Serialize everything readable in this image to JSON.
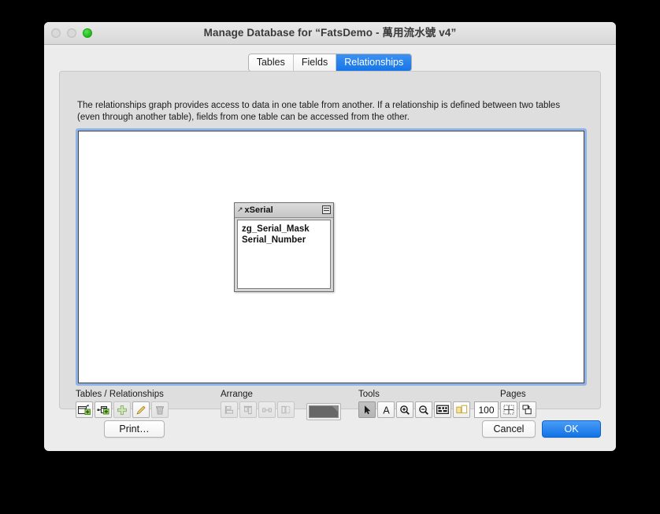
{
  "window": {
    "title": "Manage Database for “FatsDemo - 萬用流水號 v4”",
    "traffic_lights": [
      {
        "name": "close",
        "state": "disabled",
        "color": "#d9d9d9"
      },
      {
        "name": "minimize",
        "state": "disabled",
        "color": "#d9d9d9"
      },
      {
        "name": "zoom",
        "state": "enabled",
        "color": "#23c01a"
      }
    ]
  },
  "tabs": [
    {
      "label": "Tables",
      "active": false
    },
    {
      "label": "Fields",
      "active": false
    },
    {
      "label": "Relationships",
      "active": true
    }
  ],
  "description": "The relationships graph provides access to data in one table from another. If a relationship is defined between two tables (even through another table), fields from one table can be accessed from the other.",
  "graph": {
    "focus_color": "#8cb4e8",
    "tables": [
      {
        "name": "xSerial",
        "source_icon": "external-source-arrow-icon",
        "menu_icon": "table-options-icon",
        "fields": [
          "zg_Serial_Mask",
          "Serial_Number"
        ]
      }
    ]
  },
  "toolbar": {
    "groups": [
      {
        "label": "Tables / Relationships",
        "buttons": [
          {
            "icon": "add-table-icon",
            "enabled": true
          },
          {
            "icon": "add-relationship-icon",
            "enabled": true
          },
          {
            "icon": "duplicate-icon",
            "enabled": false
          },
          {
            "icon": "edit-pencil-icon",
            "enabled": true
          },
          {
            "icon": "delete-trash-icon",
            "enabled": false
          }
        ]
      },
      {
        "label": "Arrange",
        "buttons": [
          {
            "icon": "align-left-icon",
            "enabled": false
          },
          {
            "icon": "align-top-icon",
            "enabled": false
          },
          {
            "icon": "distribute-horizontal-icon",
            "enabled": false
          },
          {
            "icon": "resize-to-fit-icon",
            "enabled": false
          }
        ]
      },
      {
        "label": "Tools",
        "buttons": [
          {
            "icon": "pointer-arrow-icon",
            "enabled": true,
            "selected": true
          },
          {
            "icon": "text-tool-icon",
            "enabled": true
          },
          {
            "icon": "zoom-in-icon",
            "enabled": true
          },
          {
            "icon": "zoom-out-icon",
            "enabled": true
          },
          {
            "icon": "select-all-tables-icon",
            "enabled": true
          },
          {
            "icon": "toggle-note-icon",
            "enabled": true
          }
        ]
      },
      {
        "label": "Pages",
        "buttons": [
          {
            "icon": "page-breaks-icon",
            "enabled": true
          },
          {
            "icon": "page-setup-icon",
            "enabled": true
          }
        ]
      }
    ],
    "color_swatch": {
      "name": "table-color-swatch",
      "color": "#676767"
    },
    "zoom": {
      "value": "100",
      "unit": "%"
    }
  },
  "footer": {
    "print_label": "Print…",
    "cancel_label": "Cancel",
    "ok_label": "OK",
    "ok_color": "#1173e6"
  }
}
